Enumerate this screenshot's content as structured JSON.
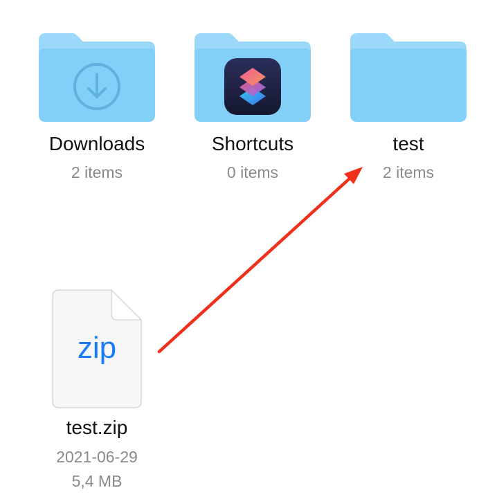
{
  "folders": [
    {
      "name": "Downloads",
      "meta": "2 items",
      "icon": "download-arrow-icon"
    },
    {
      "name": "Shortcuts",
      "meta": "0 items",
      "icon": "shortcuts-app-icon"
    },
    {
      "name": "test",
      "meta": "2 items",
      "icon": "none"
    }
  ],
  "file": {
    "icon_label": "zip",
    "name": "test.zip",
    "date": "2021-06-29",
    "size": "5,4 MB"
  },
  "annotation": {
    "arrow_color": "#f0301c"
  },
  "colors": {
    "folder_back": "#8fd3f8",
    "folder_front": "#83d0f7",
    "zip_text": "#1a7cf5"
  }
}
